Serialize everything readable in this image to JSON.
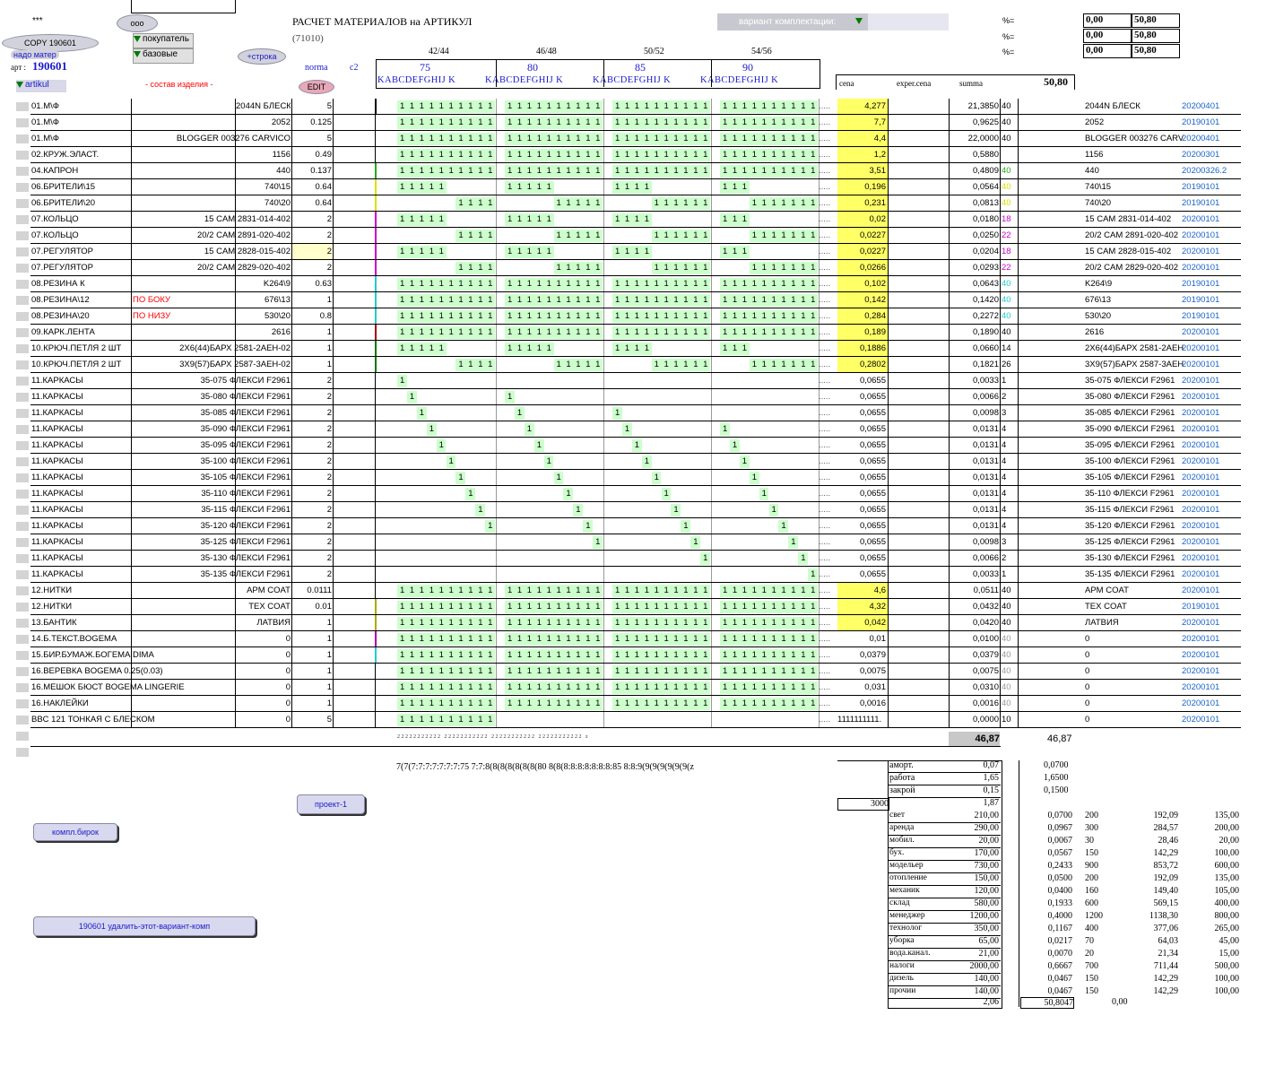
{
  "header": {
    "stars": "***",
    "title": "РАСЧЕТ МАТЕРИАЛОВ на АРТИКУЛ",
    "code": "(71010)",
    "btn_ooo": "ooo",
    "btn_copy": "COPY 190601",
    "btn_nado": "надо матер",
    "btn_pokupatel": "покупатель",
    "btn_bazovye": "базовые",
    "btn_stroka": "+строка",
    "btn_edit": "EDIT",
    "art_label": "арт :",
    "art_value": "190601",
    "artikul": "artikul",
    "sostav": "- состав изделия -",
    "norma": "norma",
    "c2": "c2",
    "variant": "вариант комплектации:",
    "sizes": [
      "42/44",
      "46/48",
      "50/52",
      "54/56"
    ],
    "size_nums": [
      "75",
      "80",
      "85",
      "90"
    ],
    "letters": "KABCDEFGHIJ K",
    "cena": "cena",
    "exper": "exper.cena",
    "summa": "summa",
    "total_top": "50,80",
    "pct_label": "%=",
    "pct_rows": [
      [
        "0,00",
        "50,80"
      ],
      [
        "0,00",
        "50,80"
      ],
      [
        "0,00",
        "50,80"
      ]
    ]
  },
  "rows": [
    {
      "name": "01.М\\Ф",
      "desc": "",
      "art": "2044N БЛЕСК",
      "norma": "5",
      "pat": "full",
      "cena": "4,277",
      "hl": true,
      "summa": "21,3850",
      "n": "40",
      "nc": "#000",
      "r1": "2044N БЛЕСК",
      "r2": "20200401"
    },
    {
      "name": "01.М\\Ф",
      "desc": "",
      "art": "2052",
      "norma": "0.125",
      "pat": "full",
      "cena": "7,7",
      "hl": true,
      "summa": "0,9625",
      "n": "40",
      "nc": "#000",
      "r1": "2052",
      "r2": "20190101"
    },
    {
      "name": "01.М\\Ф",
      "desc": "BLOGGER 003276 CARVICO",
      "art": "",
      "norma": "5",
      "pat": "full",
      "cena": "4,4",
      "hl": true,
      "summa": "22,0000",
      "n": "40",
      "nc": "#000",
      "r1": "BLOGGER 003276 CARV",
      "r2": "20200401"
    },
    {
      "name": "02.КРУЖ.ЭЛАСТ.",
      "desc": "",
      "art": "1156",
      "norma": "0.49",
      "pat": "full",
      "cena": "1,2",
      "hl": true,
      "summa": "0,5880",
      "n": "",
      "nc": "#000",
      "r1": "1156",
      "r2": "20200301"
    },
    {
      "name": "04.КАПРОН",
      "desc": "",
      "art": "440",
      "norma": "0.137",
      "pat": "full",
      "cena": "3,51",
      "hl": true,
      "summa": "0,4809",
      "n": "40",
      "nc": "#22aa22",
      "r1": "440",
      "r2": "20200326.2"
    },
    {
      "name": "06.БРИТЕЛИ\\15",
      "desc": "",
      "art": "740\\15",
      "norma": "0.64",
      "pat": "left",
      "cena": "0,196",
      "hl": true,
      "summa": "0,0564",
      "n": "40",
      "nc": "#dddd00",
      "r1": "740\\15",
      "r2": "20190101"
    },
    {
      "name": "06.БРИТЕЛИ\\20",
      "desc": "",
      "art": "740\\20",
      "norma": "0.64",
      "pat": "right",
      "cena": "0,231",
      "hl": true,
      "summa": "0,0813",
      "n": "40",
      "nc": "#dddd00",
      "r1": "740\\20",
      "r2": "20190101"
    },
    {
      "name": "07.КОЛЬЦО",
      "desc": "15 CAM 2831-014-402",
      "art": "",
      "norma": "2",
      "pat": "left",
      "cena": "0,02",
      "hl": true,
      "summa": "0,0180",
      "n": "18",
      "nc": "#cc00cc",
      "r1": "15 CAM 2831-014-402",
      "r2": "20200101"
    },
    {
      "name": "07.КОЛЬЦО",
      "desc": "20/2 CAM 2891-020-402",
      "art": "",
      "norma": "2",
      "pat": "right",
      "cena": "0,0227",
      "hl": true,
      "summa": "0,0250",
      "n": "22",
      "nc": "#cc00cc",
      "r1": "20/2 CAM 2891-020-402",
      "r2": "20200101"
    },
    {
      "name": "07.РЕГУЛЯТОР",
      "desc": "15 CAM 2828-015-402",
      "art": "",
      "norma": "2",
      "pat": "left",
      "cena": "0,0227",
      "hl": true,
      "summa": "0,0204",
      "n": "18",
      "nc": "#cc00cc",
      "r1": "15 CAM 2828-015-402",
      "r2": "20200101"
    },
    {
      "name": "07.РЕГУЛЯТОР",
      "desc": "20/2 CAM 2829-020-402",
      "art": "",
      "norma": "2",
      "pat": "right",
      "cena": "0,0266",
      "hl": true,
      "summa": "0,0293",
      "n": "22",
      "nc": "#cc00cc",
      "r1": "20/2 CAM 2829-020-402",
      "r2": "20200101"
    },
    {
      "name": "08.РЕЗИНА К",
      "desc": "",
      "art": "K264\\9",
      "norma": "0.63",
      "pat": "full",
      "cena": "0,102",
      "hl": true,
      "summa": "0,0643",
      "n": "40",
      "nc": "#22cccc",
      "r1": "K264\\9",
      "r2": "20190101"
    },
    {
      "name": "08.РЕЗИНА\\12",
      "desc": "ПО БОКУ",
      "art": "676\\13",
      "norma": "1",
      "pat": "full",
      "cena": "0,142",
      "hl": true,
      "summa": "0,1420",
      "n": "40",
      "nc": "#22cccc",
      "r1": "676\\13",
      "r2": "20190101"
    },
    {
      "name": "08.РЕЗИНА\\20",
      "desc": "ПО НИЗУ",
      "art": "530\\20",
      "norma": "0.8",
      "pat": "full",
      "cena": "0,284",
      "hl": true,
      "summa": "0,2272",
      "n": "40",
      "nc": "#22cccc",
      "r1": "530\\20",
      "r2": "20190101"
    },
    {
      "name": "09.КАРК.ЛЕНТА",
      "desc": "",
      "art": "2616",
      "norma": "1",
      "pat": "full",
      "cena": "0,189",
      "hl": true,
      "summa": "0,1890",
      "n": "40",
      "nc": "#000",
      "r1": "2616",
      "r2": "20200101"
    },
    {
      "name": "10.КРЮЧ.ПЕТЛЯ 2 ШТ",
      "desc": "2X6(44)БАРХ 2581-2АЕН-02",
      "art": "",
      "norma": "1",
      "pat": "left",
      "cena": "0,1886",
      "hl": true,
      "summa": "0,0660",
      "n": "14",
      "nc": "#000",
      "r1": "2X6(44)БАРХ 2581-2АЕН",
      "r2": "20200101"
    },
    {
      "name": "10.КРЮЧ.ПЕТЛЯ 2 ШТ",
      "desc": "3X9(57)БАРХ 2587-3АЕН-02",
      "art": "",
      "norma": "1",
      "pat": "right",
      "cena": "0,2802",
      "hl": true,
      "summa": "0,1821",
      "n": "26",
      "nc": "#000",
      "r1": "3X9(57)БАРХ 2587-3АЕН",
      "r2": "20200101"
    },
    {
      "name": "11.КАРКАСЫ",
      "desc": "35-075 ФЛЕКСИ F2961",
      "art": "",
      "norma": "2",
      "pat": "d0",
      "cena": "0,0655",
      "hl": false,
      "summa": "0,0033",
      "n": "1",
      "nc": "#000",
      "r1": "35-075 ФЛЕКСИ F2961",
      "r2": "20200101"
    },
    {
      "name": "11.КАРКАСЫ",
      "desc": "35-080 ФЛЕКСИ F2961",
      "art": "",
      "norma": "2",
      "pat": "d1",
      "cena": "0,0655",
      "hl": false,
      "summa": "0,0066",
      "n": "2",
      "nc": "#000",
      "r1": "35-080 ФЛЕКСИ F2961",
      "r2": "20200101"
    },
    {
      "name": "11.КАРКАСЫ",
      "desc": "35-085 ФЛЕКСИ F2961",
      "art": "",
      "norma": "2",
      "pat": "d2",
      "cena": "0,0655",
      "hl": false,
      "summa": "0,0098",
      "n": "3",
      "nc": "#000",
      "r1": "35-085 ФЛЕКСИ F2961",
      "r2": "20200101"
    },
    {
      "name": "11.КАРКАСЫ",
      "desc": "35-090 ФЛЕКСИ F2961",
      "art": "",
      "norma": "2",
      "pat": "d3",
      "cena": "0,0655",
      "hl": false,
      "summa": "0,0131",
      "n": "4",
      "nc": "#000",
      "r1": "35-090 ФЛЕКСИ F2961",
      "r2": "20200101"
    },
    {
      "name": "11.КАРКАСЫ",
      "desc": "35-095 ФЛЕКСИ F2961",
      "art": "",
      "norma": "2",
      "pat": "d4",
      "cena": "0,0655",
      "hl": false,
      "summa": "0,0131",
      "n": "4",
      "nc": "#000",
      "r1": "35-095 ФЛЕКСИ F2961",
      "r2": "20200101"
    },
    {
      "name": "11.КАРКАСЫ",
      "desc": "35-100 ФЛЕКСИ F2961",
      "art": "",
      "norma": "2",
      "pat": "d5",
      "cena": "0,0655",
      "hl": false,
      "summa": "0,0131",
      "n": "4",
      "nc": "#000",
      "r1": "35-100 ФЛЕКСИ F2961",
      "r2": "20200101"
    },
    {
      "name": "11.КАРКАСЫ",
      "desc": "35-105 ФЛЕКСИ F2961",
      "art": "",
      "norma": "2",
      "pat": "d6",
      "cena": "0,0655",
      "hl": false,
      "summa": "0,0131",
      "n": "4",
      "nc": "#000",
      "r1": "35-105 ФЛЕКСИ F2961",
      "r2": "20200101"
    },
    {
      "name": "11.КАРКАСЫ",
      "desc": "35-110 ФЛЕКСИ F2961",
      "art": "",
      "norma": "2",
      "pat": "d7",
      "cena": "0,0655",
      "hl": false,
      "summa": "0,0131",
      "n": "4",
      "nc": "#000",
      "r1": "35-110 ФЛЕКСИ F2961",
      "r2": "20200101"
    },
    {
      "name": "11.КАРКАСЫ",
      "desc": "35-115 ФЛЕКСИ F2961",
      "art": "",
      "norma": "2",
      "pat": "d8",
      "cena": "0,0655",
      "hl": false,
      "summa": "0,0131",
      "n": "4",
      "nc": "#000",
      "r1": "35-115 ФЛЕКСИ F2961",
      "r2": "20200101"
    },
    {
      "name": "11.КАРКАСЫ",
      "desc": "35-120 ФЛЕКСИ F2961",
      "art": "",
      "norma": "2",
      "pat": "d9",
      "cena": "0,0655",
      "hl": false,
      "summa": "0,0131",
      "n": "4",
      "nc": "#000",
      "r1": "35-120 ФЛЕКСИ F2961",
      "r2": "20200101"
    },
    {
      "name": "11.КАРКАСЫ",
      "desc": "35-125 ФЛЕКСИ F2961",
      "art": "",
      "norma": "2",
      "pat": "d10",
      "cena": "0,0655",
      "hl": false,
      "summa": "0,0098",
      "n": "3",
      "nc": "#000",
      "r1": "35-125 ФЛЕКСИ F2961",
      "r2": "20200101"
    },
    {
      "name": "11.КАРКАСЫ",
      "desc": "35-130 ФЛЕКСИ F2961",
      "art": "",
      "norma": "2",
      "pat": "d11",
      "cena": "0,0655",
      "hl": false,
      "summa": "0,0066",
      "n": "2",
      "nc": "#000",
      "r1": "35-130 ФЛЕКСИ F2961",
      "r2": "20200101"
    },
    {
      "name": "11.КАРКАСЫ",
      "desc": "35-135 ФЛЕКСИ F2961",
      "art": "",
      "norma": "2",
      "pat": "d12",
      "cena": "0,0655",
      "hl": false,
      "summa": "0,0033",
      "n": "1",
      "nc": "#000",
      "r1": "35-135 ФЛЕКСИ F2961",
      "r2": "20200101"
    },
    {
      "name": "12.НИТКИ",
      "desc": "",
      "art": "APM COAT",
      "norma": "0.0111",
      "pat": "full",
      "cena": "4,6",
      "hl": true,
      "summa": "0,0511",
      "n": "40",
      "nc": "#000",
      "r1": "APM COAT",
      "r2": "20200101"
    },
    {
      "name": "12.НИТКИ",
      "desc": "",
      "art": "TEX COAT",
      "norma": "0.01",
      "pat": "full",
      "cena": "4,32",
      "hl": true,
      "summa": "0,0432",
      "n": "40",
      "nc": "#000",
      "r1": "TEX COAT",
      "r2": "20190101"
    },
    {
      "name": "13.БАНТИК",
      "desc": "",
      "art": "ЛАТВИЯ",
      "norma": "1",
      "pat": "full",
      "cena": "0,042",
      "hl": true,
      "summa": "0,0420",
      "n": "40",
      "nc": "#000",
      "r1": "ЛАТВИЯ",
      "r2": "20200101"
    },
    {
      "name": "14.Б.ТЕКСТ.BOGEMA",
      "desc": "",
      "art": "0",
      "norma": "1",
      "pat": "full",
      "cena": "0,01",
      "hl": false,
      "summa": "0,0100",
      "n": "40",
      "nc": "#999",
      "r1": "0",
      "r2": "20200101"
    },
    {
      "name": "15.БИР.БУМАЖ.БОГЕМА DIMA",
      "desc": "",
      "art": "0",
      "norma": "1",
      "pat": "full",
      "cena": "0,0379",
      "hl": false,
      "summa": "0,0379",
      "n": "40",
      "nc": "#999",
      "r1": "0",
      "r2": "20200101"
    },
    {
      "name": "16.ВЕРЕВКА BOGEMA 0.25(0.03)",
      "desc": "",
      "art": "0",
      "norma": "1",
      "pat": "full",
      "cena": "0,0075",
      "hl": false,
      "summa": "0,0075",
      "n": "40",
      "nc": "#999",
      "r1": "0",
      "r2": "20200101"
    },
    {
      "name": "16.МЕШОК БЮСТ BOGEMA LINGERIE",
      "desc": "",
      "art": "0",
      "norma": "1",
      "pat": "full",
      "cena": "0,031",
      "hl": false,
      "summa": "0,0310",
      "n": "40",
      "nc": "#999",
      "r1": "0",
      "r2": "20200101"
    },
    {
      "name": "16.НАКЛЕЙКИ",
      "desc": "",
      "art": "0",
      "norma": "1",
      "pat": "full",
      "cena": "0,0016",
      "hl": false,
      "summa": "0,0016",
      "n": "40",
      "nc": "#999",
      "r1": "0",
      "r2": "20200101"
    },
    {
      "name": "BBC 121 ТОНКАЯ С БЛЕСКОМ",
      "desc": "",
      "art": "0",
      "norma": "5",
      "pat": "first",
      "cena": "",
      "hl": false,
      "summa": "0,0000",
      "n": "10",
      "nc": "#000",
      "r1": "0",
      "r2": "20200101",
      "dots": "1111111111."
    }
  ],
  "totals": {
    "summa": "46,87",
    "right": "46,87",
    "bottom_codes": "7(7(7:7:7:7:7:7:7:75  7:7:8(8(8(8(8(8(8(80  8(8(8:8:8:8:8:8:8:85  8:8:9(9(9(9(9(9(9(z"
  },
  "buttons": {
    "proekt": "проект-1",
    "kompl": "компл.бирок",
    "delete": "190601 удалить-этот-вариант-комп"
  },
  "costs_top": [
    {
      "label": "аморт.",
      "v1": "0,07",
      "v2": "0,0700"
    },
    {
      "label": "работа",
      "v1": "1,65",
      "v2": "1,6500"
    },
    {
      "label": "закрой",
      "v1": "0,15",
      "v2": "0,1500"
    }
  ],
  "costs_3000": "3000",
  "costs_3000_v": "1,87",
  "costs": [
    {
      "label": "свет",
      "v1": "210,00",
      "v2": "0,0700",
      "a": "200",
      "b": "192,09",
      "c": "135,00"
    },
    {
      "label": "аренда",
      "v1": "290,00",
      "v2": "0,0967",
      "a": "300",
      "b": "284,57",
      "c": "200,00"
    },
    {
      "label": "мобил.",
      "v1": "20,00",
      "v2": "0,0067",
      "a": "30",
      "b": "28,46",
      "c": "20,00"
    },
    {
      "label": "бух.",
      "v1": "170,00",
      "v2": "0,0567",
      "a": "150",
      "b": "142,29",
      "c": "100,00"
    },
    {
      "label": "модельер",
      "v1": "730,00",
      "v2": "0,2433",
      "a": "900",
      "b": "853,72",
      "c": "600,00"
    },
    {
      "label": "отопление",
      "v1": "150,00",
      "v2": "0,0500",
      "a": "200",
      "b": "192,09",
      "c": "135,00"
    },
    {
      "label": "механик",
      "v1": "120,00",
      "v2": "0,0400",
      "a": "160",
      "b": "149,40",
      "c": "105,00"
    },
    {
      "label": "склад",
      "v1": "580,00",
      "v2": "0,1933",
      "a": "600",
      "b": "569,15",
      "c": "400,00"
    },
    {
      "label": "менеджер",
      "v1": "1200,00",
      "v2": "0,4000",
      "a": "1200",
      "b": "1138,30",
      "c": "800,00"
    },
    {
      "label": "технолог",
      "v1": "350,00",
      "v2": "0,1167",
      "a": "400",
      "b": "377,06",
      "c": "265,00"
    },
    {
      "label": "уборка",
      "v1": "65,00",
      "v2": "0,0217",
      "a": "70",
      "b": "64,03",
      "c": "45,00"
    },
    {
      "label": "вода.канал.",
      "v1": "21,00",
      "v2": "0,0070",
      "a": "20",
      "b": "21,34",
      "c": "15,00"
    },
    {
      "label": "налоги",
      "v1": "2000,00",
      "v2": "0,6667",
      "a": "700",
      "b": "711,44",
      "c": "500,00"
    },
    {
      "label": "дизель",
      "v1": "140,00",
      "v2": "0,0467",
      "a": "150",
      "b": "142,29",
      "c": "100,00"
    },
    {
      "label": "прочии",
      "v1": "140,00",
      "v2": "0,0467",
      "a": "150",
      "b": "142,29",
      "c": "100,00"
    }
  ],
  "costs_footer": {
    "v1": "2,06",
    "v2": "50,8047",
    "v3": "0,00"
  },
  "colors": {
    "green": "#ccffcc",
    "yellow": "#ffff66",
    "blue_text": "#1a64c8",
    "red_text": "#ff0000"
  }
}
